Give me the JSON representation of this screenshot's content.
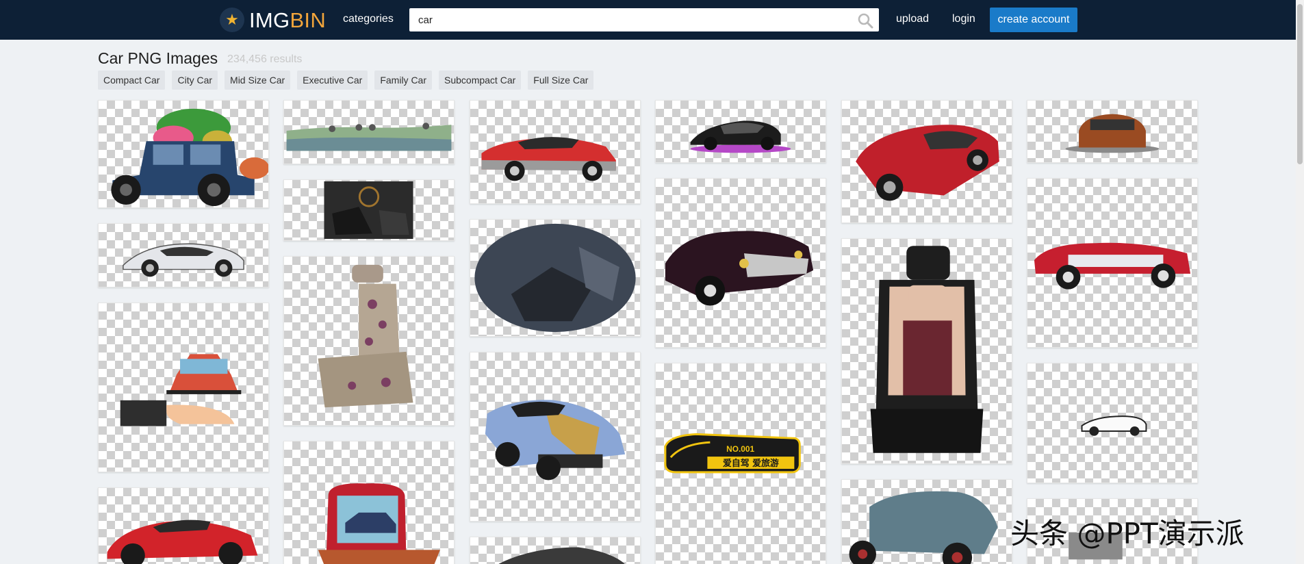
{
  "header": {
    "logo_part1": "IMG",
    "logo_part2": "BIN",
    "nav_categories": "categories",
    "search_value": "car",
    "nav_upload": "upload",
    "nav_login": "login",
    "create_account": "create account"
  },
  "main": {
    "title": "Car PNG Images",
    "results": "234,456 results",
    "tags": [
      "Compact Car",
      "City Car",
      "Mid Size Car",
      "Executive Car",
      "Family Car",
      "Subcompact Car",
      "Full Size Car"
    ]
  },
  "grid_items": [
    {
      "label": "green blob car"
    },
    {
      "label": "flat vehicle panorama"
    },
    {
      "label": "red coupe"
    },
    {
      "label": "black sports car"
    },
    {
      "label": "red convertible"
    },
    {
      "label": "orange suv rear"
    },
    {
      "label": "car interior seats"
    },
    {
      "label": "white bmw i8"
    },
    {
      "label": "car interior oval"
    },
    {
      "label": "classic black car"
    },
    {
      "label": "car seat cover"
    },
    {
      "label": "red classic convertible"
    },
    {
      "label": "floral car seat"
    },
    {
      "label": "hand holding car"
    },
    {
      "label": "black and red car seat"
    },
    {
      "label": "blue muscle car"
    },
    {
      "label": "small sketch convertible"
    },
    {
      "label": "yellow car badge"
    },
    {
      "label": "red sports car"
    },
    {
      "label": "car in gift box"
    },
    {
      "label": "dark sedan"
    },
    {
      "label": "blue vintage car"
    },
    {
      "label": "partial car"
    }
  ],
  "badge": {
    "number": "NO.001",
    "text": "爱自驾 爱旅游"
  },
  "watermark": "头条 @PPT演示派",
  "colors": {
    "header_bg": "#0d2036",
    "accent": "#1a7bc9",
    "logo_orange": "#f2a53b",
    "page_bg": "#eef1f4"
  }
}
